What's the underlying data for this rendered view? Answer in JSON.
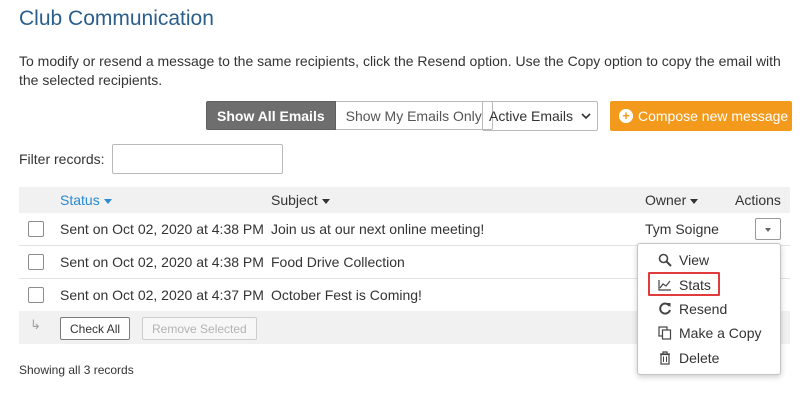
{
  "page": {
    "title": "Club Communication",
    "intro": "To modify or resend a message to the same recipients, click the Resend option. Use the Copy option to copy the email with the selected recipients."
  },
  "toolbar": {
    "show_all": "Show All Emails",
    "show_mine": "Show My Emails Only",
    "filter_select": "Active Emails",
    "compose": "Compose new message"
  },
  "filter": {
    "label": "Filter records:",
    "value": ""
  },
  "table": {
    "headers": {
      "status": "Status",
      "subject": "Subject",
      "owner": "Owner",
      "actions": "Actions"
    },
    "rows": [
      {
        "status": "Sent on Oct 02, 2020 at 4:38 PM",
        "subject": "Join us at our next online meeting!",
        "owner": "Tym Soigne"
      },
      {
        "status": "Sent on Oct 02, 2020 at 4:38 PM",
        "subject": "Food Drive Collection",
        "owner": ""
      },
      {
        "status": "Sent on Oct 02, 2020 at 4:37 PM",
        "subject": "October Fest is Coming!",
        "owner": ""
      }
    ]
  },
  "bulk": {
    "check_all": "Check All",
    "remove_selected": "Remove Selected"
  },
  "footer": {
    "showing": "Showing all 3 records"
  },
  "actions_menu": {
    "items": [
      {
        "label": "View",
        "icon": "search-icon"
      },
      {
        "label": "Stats",
        "icon": "chart-icon"
      },
      {
        "label": "Resend",
        "icon": "refresh-icon"
      },
      {
        "label": "Make a Copy",
        "icon": "copy-icon"
      },
      {
        "label": "Delete",
        "icon": "trash-icon"
      }
    ],
    "highlighted": "Stats"
  },
  "colors": {
    "accent": "#2a5f8c",
    "sort_link": "#2a8ad4",
    "compose": "#f39a1d",
    "highlight": "#e23b3b"
  }
}
